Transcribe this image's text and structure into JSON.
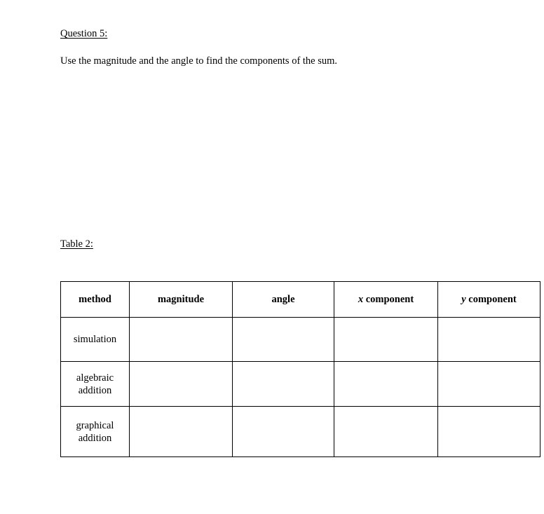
{
  "question": {
    "label": "Question 5:",
    "prompt": "Use the magnitude and the angle to find the components of the sum."
  },
  "table_section": {
    "caption": "Table 2:"
  },
  "table": {
    "headers": [
      {
        "symbol": "",
        "text": "method"
      },
      {
        "symbol": "",
        "text": "magnitude"
      },
      {
        "symbol": "",
        "text": "angle"
      },
      {
        "symbol": "x",
        "text": " component"
      },
      {
        "symbol": "y",
        "text": " component"
      }
    ],
    "rows": [
      {
        "method": "simulation",
        "magnitude": "",
        "angle": "",
        "x_component": "",
        "y_component": ""
      },
      {
        "method": "algebraic\naddition",
        "magnitude": "",
        "angle": "",
        "x_component": "",
        "y_component": ""
      },
      {
        "method": "graphical\naddition",
        "magnitude": "",
        "angle": "",
        "x_component": "",
        "y_component": ""
      }
    ]
  },
  "style": {
    "page_background": "#ffffff",
    "text_color": "#000000",
    "border_color": "#000000"
  }
}
